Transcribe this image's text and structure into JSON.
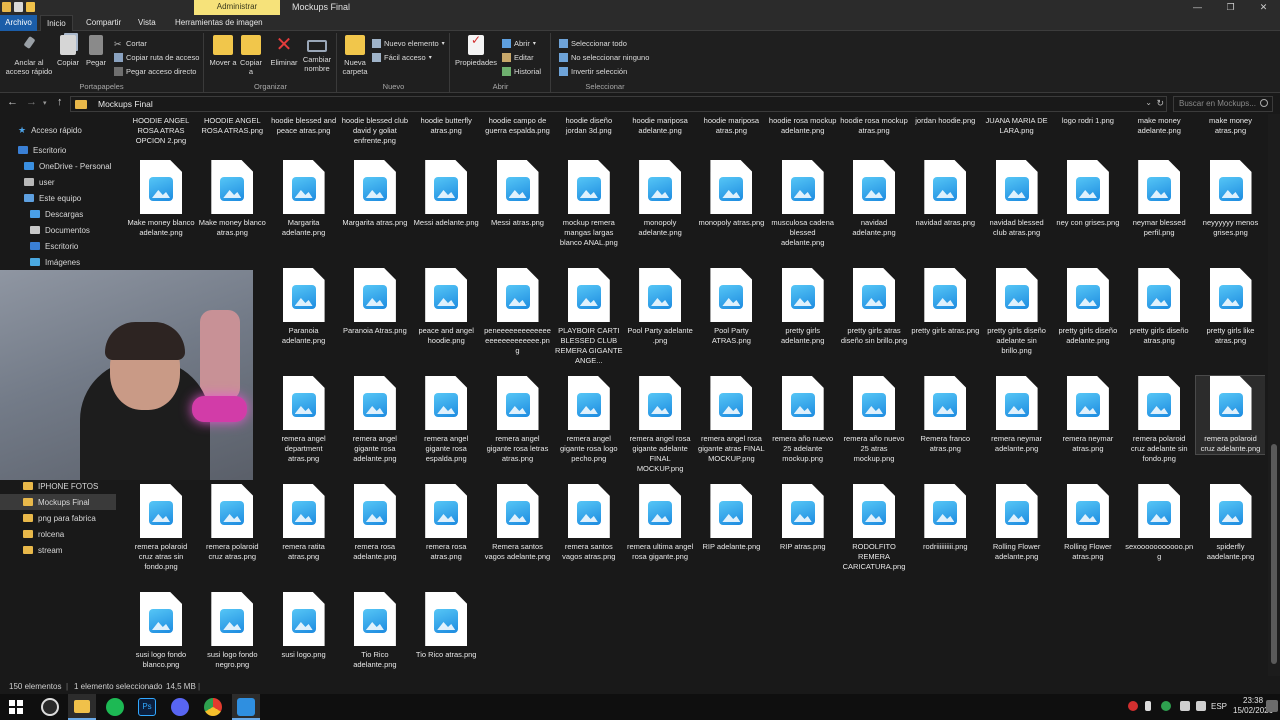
{
  "window": {
    "context_tab": "Administrar",
    "title": "Mockups Final",
    "controls": [
      "—",
      "❐",
      "✕"
    ]
  },
  "ribbon_tabs": [
    "Archivo",
    "Inicio",
    "Compartir",
    "Vista",
    "Herramientas de imagen"
  ],
  "ribbon": {
    "portapapeles": {
      "label": "Portapapeles",
      "pin": "Anclar al acceso rápido",
      "copy": "Copiar",
      "paste": "Pegar",
      "cut": "Cortar",
      "copy_path": "Copiar ruta de acceso",
      "paste_shortcut": "Pegar acceso directo"
    },
    "organizar": {
      "label": "Organizar",
      "move": "Mover a",
      "copy_to": "Copiar a",
      "delete": "Eliminar",
      "rename": "Cambiar nombre"
    },
    "nuevo": {
      "label": "Nuevo",
      "new_folder": "Nueva carpeta",
      "new_item": "Nuevo elemento",
      "easy_access": "Fácil acceso"
    },
    "abrir": {
      "label": "Abrir",
      "properties": "Propiedades",
      "open": "Abrir",
      "edit": "Editar",
      "history": "Historial"
    },
    "seleccionar": {
      "label": "Seleccionar",
      "select_all": "Seleccionar todo",
      "select_none": "No seleccionar ninguno",
      "invert": "Invertir selección"
    }
  },
  "address": {
    "path": "Mockups Final",
    "search_placeholder": "Buscar en Mockups..."
  },
  "sidebar": {
    "quick_access": "Acceso rápido",
    "items_top": [
      {
        "label": "Escritorio",
        "color": "#3a7fd4"
      },
      {
        "label": "OneDrive - Personal",
        "color": "#3a8fe0"
      },
      {
        "label": "user",
        "color": "#b8b8b8"
      },
      {
        "label": "Este equipo",
        "color": "#5ea0e0"
      },
      {
        "label": "Descargas",
        "color": "#4aa0e8"
      },
      {
        "label": "Documentos",
        "color": "#c8c8c8"
      },
      {
        "label": "Escritorio",
        "color": "#3a7fd4"
      },
      {
        "label": "Imágenes",
        "color": "#4aa8e0"
      }
    ],
    "items_bottom": [
      {
        "label": "IPHONE FOTOS",
        "color": "#e8b84a"
      },
      {
        "label": "Mockups Final",
        "color": "#e8b84a"
      },
      {
        "label": "png para fabrica",
        "color": "#e8b84a"
      },
      {
        "label": "rolcena",
        "color": "#e8b84a"
      },
      {
        "label": "stream",
        "color": "#e8b84a"
      }
    ],
    "selected": "Mockups Final"
  },
  "files": {
    "top_row": [
      "HOODIE ANGEL ROSA ATRAS OPCION 2.png",
      "HOODIE ANGEL ROSA ATRAS.png",
      "hoodie blessed and peace atras.png",
      "hoodie blessed club david y goliat enfrente.png",
      "hoodie butterfly atras.png",
      "hoodie campo de guerra espalda.png",
      "hoodie diseño jordan 3d.png",
      "hoodie mariposa adelante.png",
      "hoodie mariposa atras.png",
      "hoodie rosa mockup adelante.png",
      "hoodie rosa mockup atras.png",
      "jordan hoodie.png",
      "JUANA MARIA DE LARA.png",
      "logo rodri 1.png",
      "make money adelante.png",
      "make money atras.png"
    ],
    "rows": [
      [
        "Make money blanco adelante.png",
        "Make money blanco atras.png",
        "Margarita adelante.png",
        "Margarita atras.png",
        "Messi adelante.png",
        "Messi atras.png",
        "mockup remera mangas largas blanco ANAL.png",
        "monopoly adelante.png",
        "monopoly atras.png",
        "musculosa cadena blessed adelante.png",
        "navidad adelante.png",
        "navidad atras.png",
        "navidad blessed club atras.png",
        "ney con grises.png",
        "neymar blessed perfil.png",
        "neyyyyyy menos grises.png"
      ],
      [
        "",
        "",
        "Paranoia adelante.png",
        "Paranoia Atras.png",
        "peace and angel hoodie.png",
        "peneeeeeeeeeeeeeeeeeeeeeeeeee.png",
        "PLAYBOIR CARTI BLESSED CLUB REMERA GIGANTE ANGE...",
        "Pool Party adelante .png",
        "Pool Party ATRAS.png",
        "pretty girls adelante.png",
        "pretty girls atras diseño sin brillo.png",
        "pretty girls atras.png",
        "pretty girls diseño adelante sin brillo.png",
        "pretty girls diseño adelante.png",
        "pretty girls diseño atras.png",
        "pretty girls like atras.png"
      ],
      [
        "",
        "",
        "remera angel department atras.png",
        "remera angel gigante rosa adelante.png",
        "remera angel gigante rosa espalda.png",
        "remera angel gigante rosa letras atras.png",
        "remera angel gigante rosa logo pecho.png",
        "remera angel rosa gigante adelante FINAL MOCKUP.png",
        "remera angel rosa gigante atras FINAL MOCKUP.png",
        "remera año nuevo 25 adelante mockup.png",
        "remera año nuevo 25 atras mockup.png",
        "Remera franco atras.png",
        "remera neymar adelante.png",
        "remera neymar atras.png",
        "remera polaroid cruz adelante sin fondo.png",
        "remera polaroid cruz adelante.png"
      ],
      [
        "remera polaroid cruz atras sin fondo.png",
        "remera polaroid cruz atras.png",
        "remera ratita atras.png",
        "remera rosa adelante.png",
        "remera rosa atras.png",
        "Remera santos vagos adelante.png",
        "remera santos vagos atras.png",
        "remera ultima angel rosa gigante.png",
        "RIP adelante.png",
        "RIP atras.png",
        "RODOLFITO REMERA CARICATURA.png",
        "rodriiiiiiiiii.png",
        "Rolling Flower adelante.png",
        "Rolling Flower atras.png",
        "sexooooooooooo.png",
        "spiderfly aadelante.png"
      ],
      [
        "susi logo fondo blanco.png",
        "susi logo fondo negro.png",
        "susi logo.png",
        "Tio Rico adelante.png",
        "Tio Rico atras.png"
      ]
    ],
    "selected_row": 2,
    "selected_col": 15
  },
  "status": {
    "count": "150 elementos",
    "selection": "1 elemento seleccionado",
    "size": "14,5 MB"
  },
  "taskbar": {
    "lang": "ESP",
    "time": "23:38",
    "date": "15/02/2026",
    "apps": [
      "start-icon",
      "obs-icon",
      "file-explorer-icon",
      "spotify-icon",
      "photoshop-icon",
      "discord-icon",
      "chrome-icon",
      "photos-icon"
    ],
    "colors": {
      "spotify": "#1db954",
      "photoshop": "#0b1e3c",
      "discord": "#5865f2",
      "chrome": "#e33b2e",
      "obs": "#2a2a2a",
      "explorer": "#f0c14a",
      "photos": "#2f8fe0"
    }
  }
}
